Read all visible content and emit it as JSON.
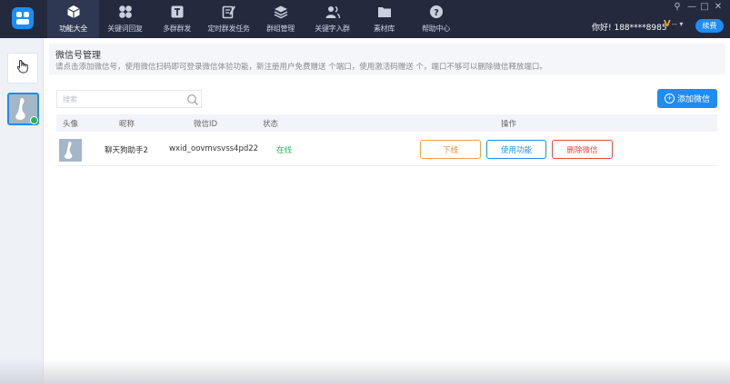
{
  "topbar": {
    "nav": [
      {
        "label": "功能大全",
        "icon": "cube-icon",
        "active": true
      },
      {
        "label": "关键词回复",
        "icon": "clover-icon",
        "active": false
      },
      {
        "label": "多群群发",
        "icon": "text-square-icon",
        "active": false
      },
      {
        "label": "定时群发任务",
        "icon": "edit-icon",
        "active": false
      },
      {
        "label": "群组管理",
        "icon": "layers-icon",
        "active": false
      },
      {
        "label": "关键字入群",
        "icon": "users-icon",
        "active": false
      },
      {
        "label": "素材库",
        "icon": "folder-icon",
        "active": false
      },
      {
        "label": "帮助中心",
        "icon": "help-icon",
        "active": false
      }
    ],
    "greeting": "你好! 188****8985",
    "vip_mark": "V",
    "vip_dropdown": "-- ▾",
    "renew_label": "续费",
    "window_controls": [
      "⚲",
      "—",
      "□",
      "✕"
    ]
  },
  "main": {
    "title": "微信号管理",
    "description": "请点击添加微信号，使用微信扫码即可登录微信体验功能，新注册用户免费赠送 个端口，使用激活码赠送 个，端口不够可以删除微信释放端口。",
    "search_placeholder": "搜索",
    "add_button_label": "添加微信",
    "table": {
      "headers": {
        "avatar": "头像",
        "nickname": "昵称",
        "wechat_id": "微信ID",
        "status": "状态",
        "actions": "操作"
      },
      "rows": [
        {
          "nickname": "聊天狗助手2",
          "wechat_id": "wxid_oovmvsvss4pd22",
          "status": "在线",
          "actions": {
            "offline": "下线",
            "use": "使用功能",
            "delete": "删除微信"
          }
        }
      ]
    }
  },
  "colors": {
    "topbar": "#232a3e",
    "accent": "#1e8cf2",
    "online": "#22b559",
    "offline_button": "#f08a24",
    "delete_button": "#e8463c"
  }
}
